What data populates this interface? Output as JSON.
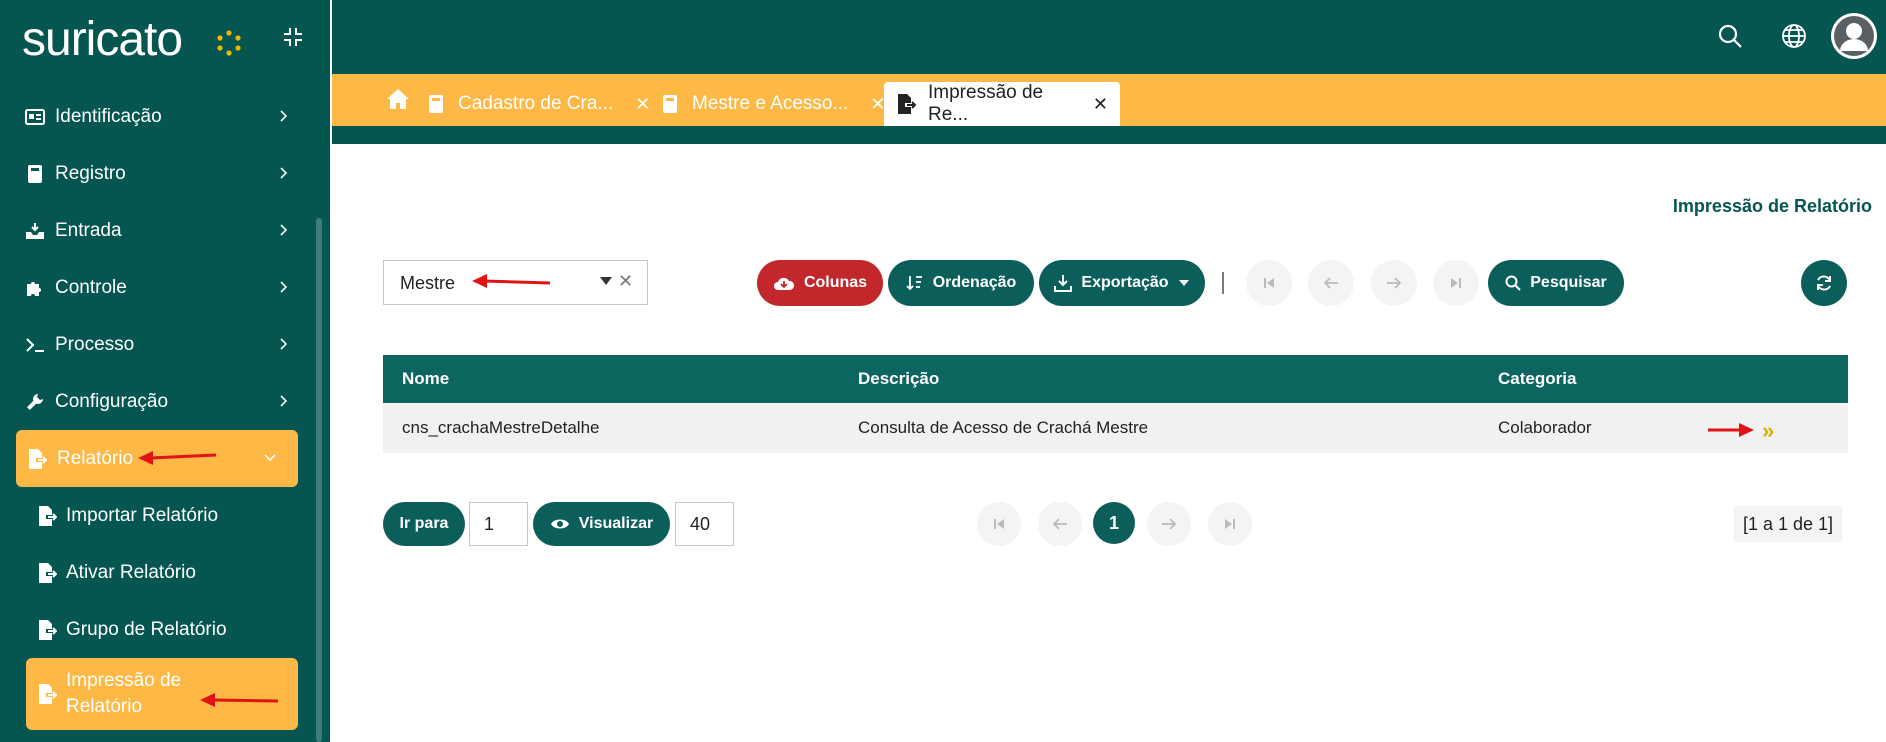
{
  "brand": {
    "logo_text": "suricato"
  },
  "sidebar": {
    "items": [
      {
        "label": "Identificação"
      },
      {
        "label": "Registro"
      },
      {
        "label": "Entrada"
      },
      {
        "label": "Controle"
      },
      {
        "label": "Processo"
      },
      {
        "label": "Configuração"
      },
      {
        "label": "Relatório"
      }
    ],
    "subitems": [
      {
        "label": "Importar Relatório"
      },
      {
        "label": "Ativar Relatório"
      },
      {
        "label": "Grupo de Relatório"
      },
      {
        "label_line1": "Impressão de",
        "label_line2": "Relatório"
      }
    ]
  },
  "tabs": [
    {
      "label": "Cadastro de Cra...",
      "close": "✕"
    },
    {
      "label": "Mestre e Acesso...",
      "close": "✕"
    },
    {
      "label": "Impressão de Re...",
      "close": "✕"
    }
  ],
  "page": {
    "title": "Impressão de Relatório"
  },
  "filter": {
    "value": "Mestre"
  },
  "toolbar": {
    "columns": "Colunas",
    "sort": "Ordenação",
    "export": "Exportação",
    "search": "Pesquisar"
  },
  "table": {
    "headers": [
      "Nome",
      "Descrição",
      "Categoria"
    ],
    "rows": [
      [
        "cns_crachaMestreDetalhe",
        "Consulta de Acesso de Crachá Mestre",
        "Colaborador"
      ]
    ],
    "row_action": "»"
  },
  "pager": {
    "goto_label": "Ir para",
    "goto_value": "1",
    "view_label": "Visualizar",
    "page_size": "40",
    "current_page": "1",
    "summary": "[1 a 1 de 1]"
  },
  "colors": {
    "sidebar": "#055550",
    "accent": "#fdb845",
    "primary_btn": "#0b5e5a",
    "danger_btn": "#c2282b",
    "annotation_arrow": "#e01414"
  }
}
